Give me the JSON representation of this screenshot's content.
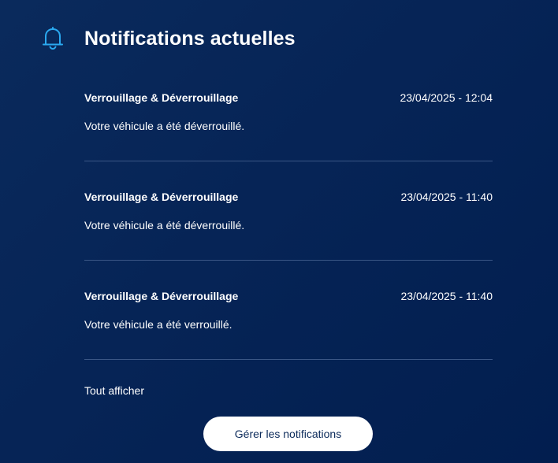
{
  "header": {
    "title": "Notifications actuelles",
    "icon": "bell-icon",
    "icon_color": "#2aa9f0"
  },
  "notifications": [
    {
      "title": "Verrouillage & Déverrouillage",
      "date": "23/04/2025 - 12:04",
      "message": "Votre véhicule a été déverrouillé."
    },
    {
      "title": "Verrouillage & Déverrouillage",
      "date": "23/04/2025 - 11:40",
      "message": "Votre véhicule a été déverrouillé."
    },
    {
      "title": "Verrouillage & Déverrouillage",
      "date": "23/04/2025 - 11:40",
      "message": "Votre véhicule a été verrouillé."
    }
  ],
  "footer": {
    "show_all_label": "Tout afficher",
    "manage_button_label": "Gérer les notifications"
  },
  "colors": {
    "background": "#062456",
    "divider": "#3a5685",
    "button_bg": "#ffffff",
    "button_text": "#0b2a5a"
  }
}
